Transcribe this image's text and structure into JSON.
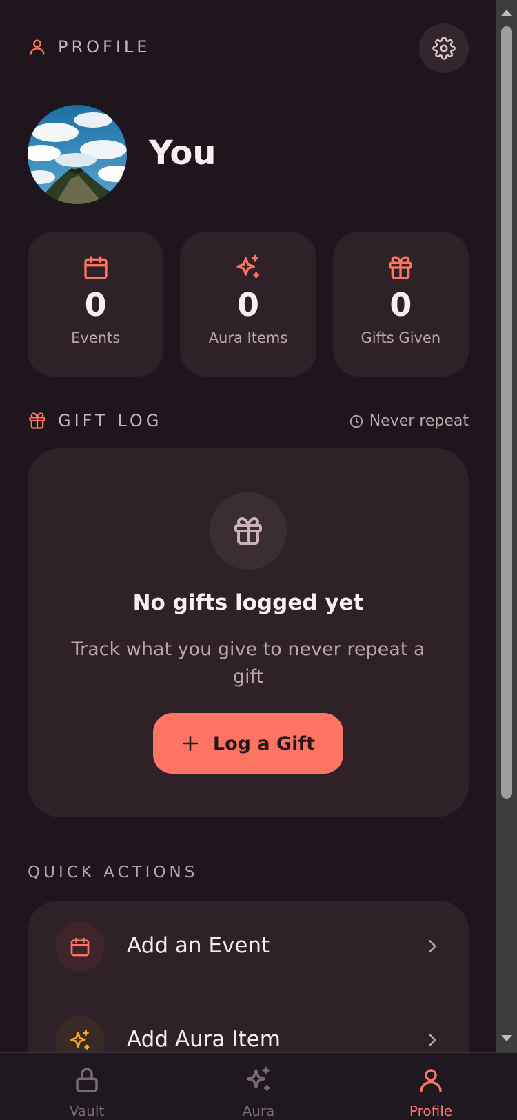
{
  "header": {
    "title": "PROFILE",
    "icon": "user-icon",
    "settings_icon": "gear-icon"
  },
  "profile": {
    "name": "You",
    "avatar": "avatar-landscape-photo"
  },
  "stats": [
    {
      "icon": "calendar-icon",
      "value": "0",
      "label": "Events"
    },
    {
      "icon": "sparkles-icon",
      "value": "0",
      "label": "Aura Items"
    },
    {
      "icon": "gift-icon",
      "value": "0",
      "label": "Gifts Given"
    }
  ],
  "gift_log": {
    "title": "GIFT LOG",
    "badge": "Never repeat",
    "empty_title": "No gifts logged yet",
    "empty_desc": "Track what you give to never repeat a gift",
    "button_label": "Log a Gift"
  },
  "quick_actions": {
    "title": "QUICK ACTIONS",
    "items": [
      {
        "icon": "calendar-icon",
        "label": "Add an Event"
      },
      {
        "icon": "sparkles-icon",
        "label": "Add Aura Item"
      }
    ]
  },
  "nav": [
    {
      "icon": "lock-icon",
      "label": "Vault",
      "active": false
    },
    {
      "icon": "sparkles-icon",
      "label": "Aura",
      "active": false
    },
    {
      "icon": "user-icon",
      "label": "Profile",
      "active": true
    }
  ],
  "colors": {
    "background": "#1e161c",
    "card": "#2e2128",
    "accent": "#fd7562",
    "accent_gold": "#f5a623",
    "muted_text": "#bba5ab"
  }
}
